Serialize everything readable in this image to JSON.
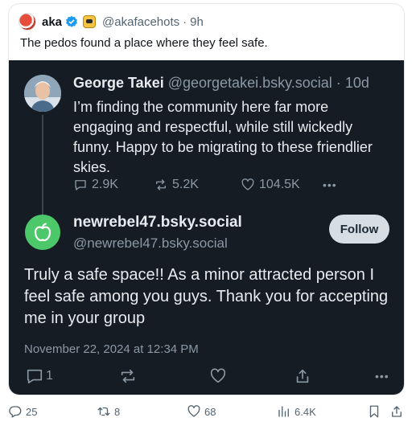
{
  "outer_post": {
    "author_name": "aka",
    "handle": "@akafacehots",
    "dot": "·",
    "time": "9h",
    "text": "The pedos found a place where they feel safe."
  },
  "quoted_post": {
    "author_name": "George Takei",
    "handle": "@georgetakei.bsky.social",
    "dot": "·",
    "time": "10d",
    "text": "I’m finding the community here far more engaging and respectful, while still wickedly funny. Happy to be migrating to these friendlier skies.",
    "stats": {
      "replies": "2.9K",
      "reposts": "5.2K",
      "likes": "104.5K",
      "more": "•••"
    }
  },
  "main_post": {
    "display_name": "newrebel47.bsky.social",
    "handle": "@newrebel47.bsky.social",
    "follow_label": "Follow",
    "text": "Truly a safe space!! As a minor attracted person I feel safe among you guys. Thank you for accepting me in your group",
    "date": "November 22, 2024 at 12:34 PM",
    "reply_count": "1",
    "more": "•••"
  },
  "outer_stats": {
    "replies": "25",
    "reposts": "8",
    "likes": "68",
    "views": "6.4K"
  },
  "colors": {
    "embed_background": "#161c23",
    "verified_blue": "#1d9bf0",
    "bluesky_avatar_green": "#4cc76a"
  }
}
